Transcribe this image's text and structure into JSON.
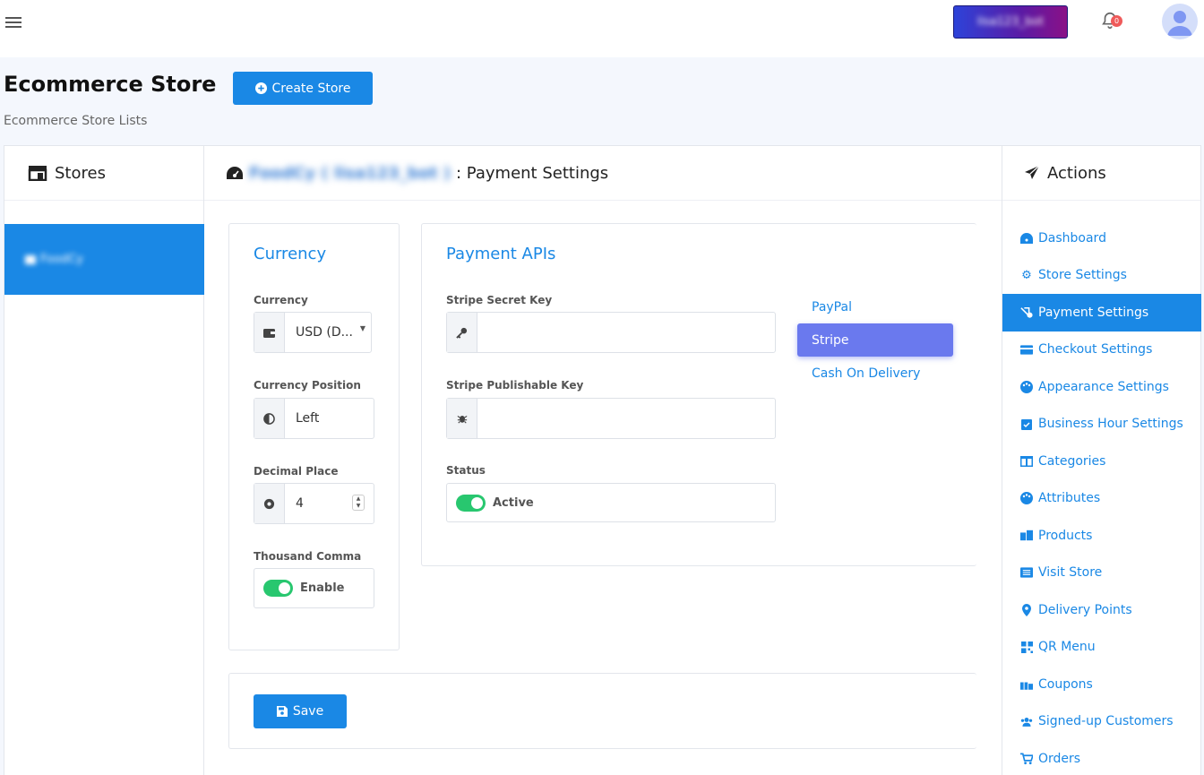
{
  "topbar": {
    "bot_button_label": "lisa123_bot",
    "notification_count": "0"
  },
  "header": {
    "title": "Ecommerce Store",
    "create_label": "Create Store",
    "subtitle": "Ecommerce Store Lists"
  },
  "stores": {
    "title": "Stores",
    "items": [
      {
        "label": "FoodCy"
      }
    ]
  },
  "main": {
    "store_name": "FoodCy ( lisa123_bot )",
    "section_title": ": Payment Settings",
    "currency_card": {
      "title": "Currency",
      "currency_label": "Currency",
      "currency_value": "USD (D...",
      "position_label": "Currency Position",
      "position_value": "Left",
      "decimal_label": "Decimal Place",
      "decimal_value": "4",
      "comma_label": "Thousand Comma",
      "comma_value": "Enable"
    },
    "payment_card": {
      "title": "Payment APIs",
      "secret_label": "Stripe Secret Key",
      "secret_value": "",
      "publishable_label": "Stripe Publishable Key",
      "publishable_value": "",
      "status_label": "Status",
      "status_value": "Active",
      "tabs": [
        {
          "label": "PayPal",
          "active": false
        },
        {
          "label": "Stripe",
          "active": true
        },
        {
          "label": "Cash On Delivery",
          "active": false
        }
      ]
    },
    "save_label": "Save"
  },
  "actions": {
    "title": "Actions",
    "items": [
      {
        "label": "Dashboard",
        "icon": "dashboard-icon"
      },
      {
        "label": "Store Settings",
        "icon": "gear-icon"
      },
      {
        "label": "Payment Settings",
        "icon": "payment-icon",
        "active": true
      },
      {
        "label": "Checkout Settings",
        "icon": "credit-card-icon"
      },
      {
        "label": "Appearance Settings",
        "icon": "palette-icon"
      },
      {
        "label": "Business Hour Settings",
        "icon": "calendar-icon"
      },
      {
        "label": "Categories",
        "icon": "columns-icon"
      },
      {
        "label": "Attributes",
        "icon": "palette-icon"
      },
      {
        "label": "Products",
        "icon": "boxes-icon"
      },
      {
        "label": "Visit Store",
        "icon": "list-icon"
      },
      {
        "label": "Delivery Points",
        "icon": "map-marker-icon"
      },
      {
        "label": "QR Menu",
        "icon": "qrcode-icon"
      },
      {
        "label": "Coupons",
        "icon": "gift-icon"
      },
      {
        "label": "Signed-up Customers",
        "icon": "users-icon"
      },
      {
        "label": "Orders",
        "icon": "cart-icon"
      }
    ]
  },
  "colors": {
    "primary": "#1a88e5",
    "active_tab": "#6a79ee",
    "toggle_on": "#28c76f",
    "badge": "#ef5a5a"
  }
}
